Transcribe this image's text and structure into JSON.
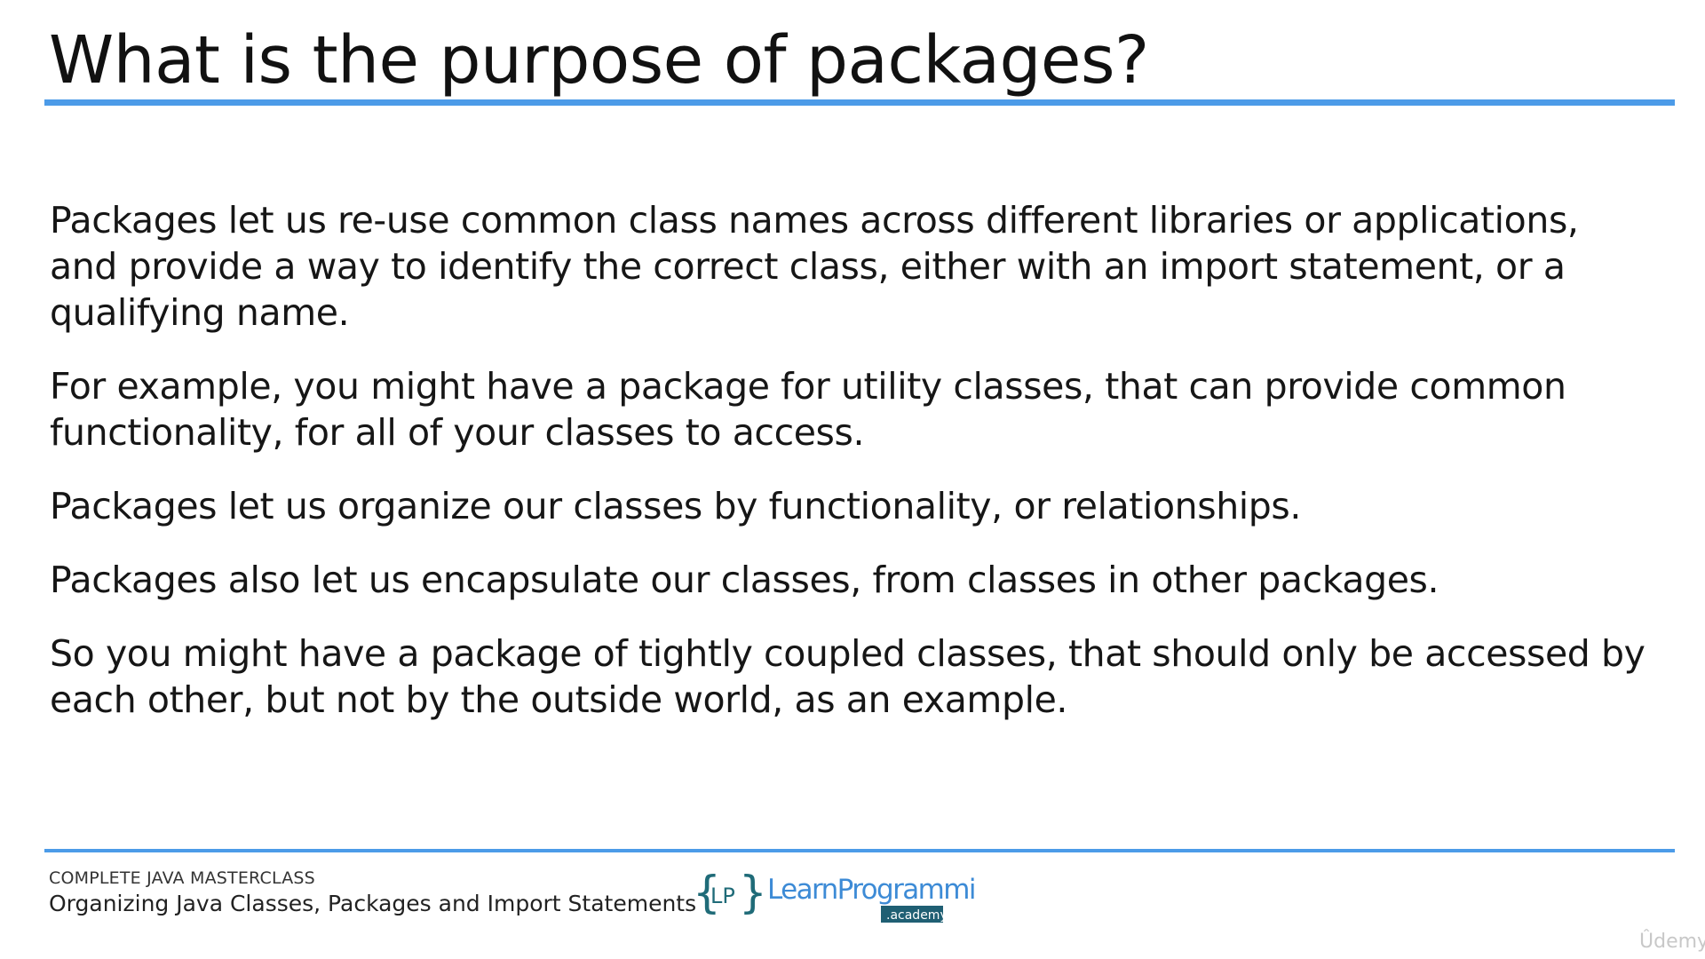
{
  "slide": {
    "title": "What is the purpose of packages?",
    "paragraphs": [
      "Packages let us re-use common class names across different libraries or applications, and provide a way to identify the correct class, either with an import statement, or a qualifying name.",
      "For example, you might have a package for utility classes, that can provide common functionality, for all of your classes to access.",
      "Packages let us organize our classes by functionality, or relationships.",
      "Packages also let us encapsulate our classes, from classes in other packages.",
      "So you might have a package of tightly coupled classes, that should only be accessed by each other, but not by the outside world, as an example."
    ]
  },
  "footer": {
    "course": "COMPLETE JAVA MASTERCLASS",
    "lecture": "Organizing Java Classes, Packages and Import Statements",
    "logo": {
      "icon": "lp-braces-logo-icon",
      "mark": "LP",
      "name": "LearnProgramming",
      "sub": ".academy"
    },
    "watermark": "Ûdemy"
  },
  "colors": {
    "accent": "#4c9be8",
    "logo_teal": "#1f6b78",
    "logo_blue": "#3d8bd6",
    "badge": "#1f5f73"
  }
}
